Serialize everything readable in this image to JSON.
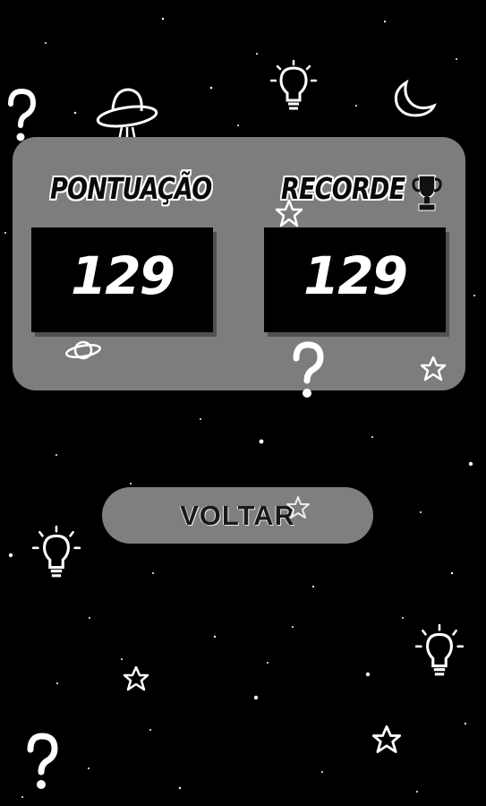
{
  "score_panel": {
    "score_label": "PONTUAÇÃO",
    "record_label": "RECORDE",
    "score_value": "129",
    "record_value": "129"
  },
  "back_button": {
    "label": "VOLTAR"
  },
  "icons": {
    "trophy": "trophy-icon",
    "ufo": "ufo-icon",
    "lightbulb": "lightbulb-icon",
    "moon": "moon-icon",
    "question_mark": "question-mark-icon",
    "star": "star-icon",
    "planet": "planet-icon"
  },
  "colors": {
    "background": "#000000",
    "panel": "#7d7d7d",
    "score_box": "#000000",
    "button": "#7f7f7f",
    "text_light": "#ffffff"
  }
}
